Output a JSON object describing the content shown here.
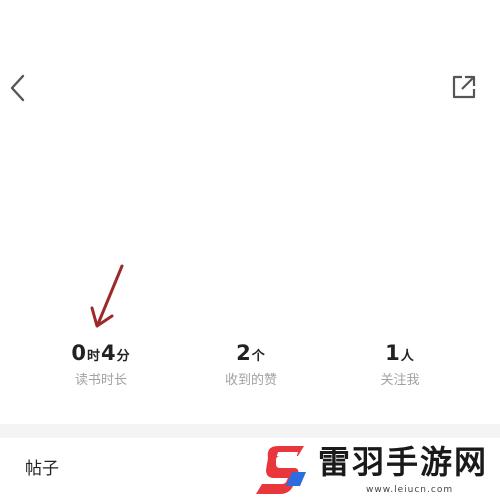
{
  "header": {
    "back_icon": "chevron-left-icon",
    "share_icon": "external-link-icon"
  },
  "annotation": {
    "icon": "red-arrow-annotation",
    "color": "#9b2b2b"
  },
  "stats": [
    {
      "label": "读书时长",
      "hours": "0",
      "hours_unit": "时",
      "minutes": "4",
      "minutes_unit": "分"
    },
    {
      "label": "收到的赞",
      "value": "2",
      "unit": "个"
    },
    {
      "label": "关注我",
      "value": "1",
      "unit": "人"
    }
  ],
  "tabs": {
    "posts_label": "帖子"
  },
  "watermark": {
    "title": "雷羽手游网",
    "url": "www.leiucn.com",
    "logo_colors": [
      "#e8363c",
      "#2b6de0"
    ]
  }
}
